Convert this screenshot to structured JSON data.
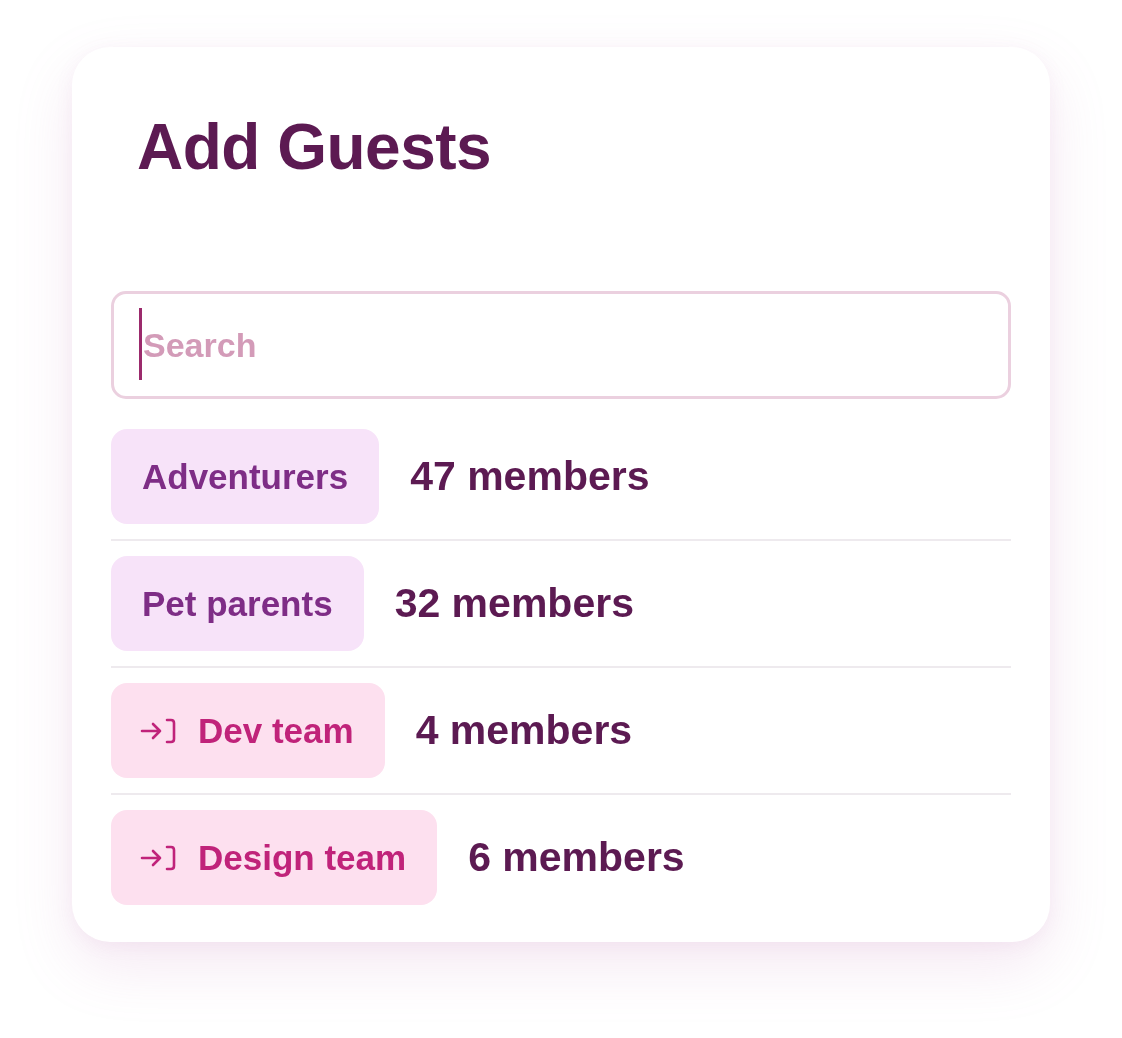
{
  "title": "Add Guests",
  "search": {
    "placeholder": "Search",
    "focused": true
  },
  "groups": [
    {
      "kind": "plain",
      "label": "Adventurers",
      "members": "47 members"
    },
    {
      "kind": "plain",
      "label": "Pet parents",
      "members": "32 members"
    },
    {
      "kind": "sign-in",
      "label": "Dev team",
      "members": "4 members"
    },
    {
      "kind": "sign-in",
      "label": "Design team",
      "members": "6 members"
    }
  ]
}
